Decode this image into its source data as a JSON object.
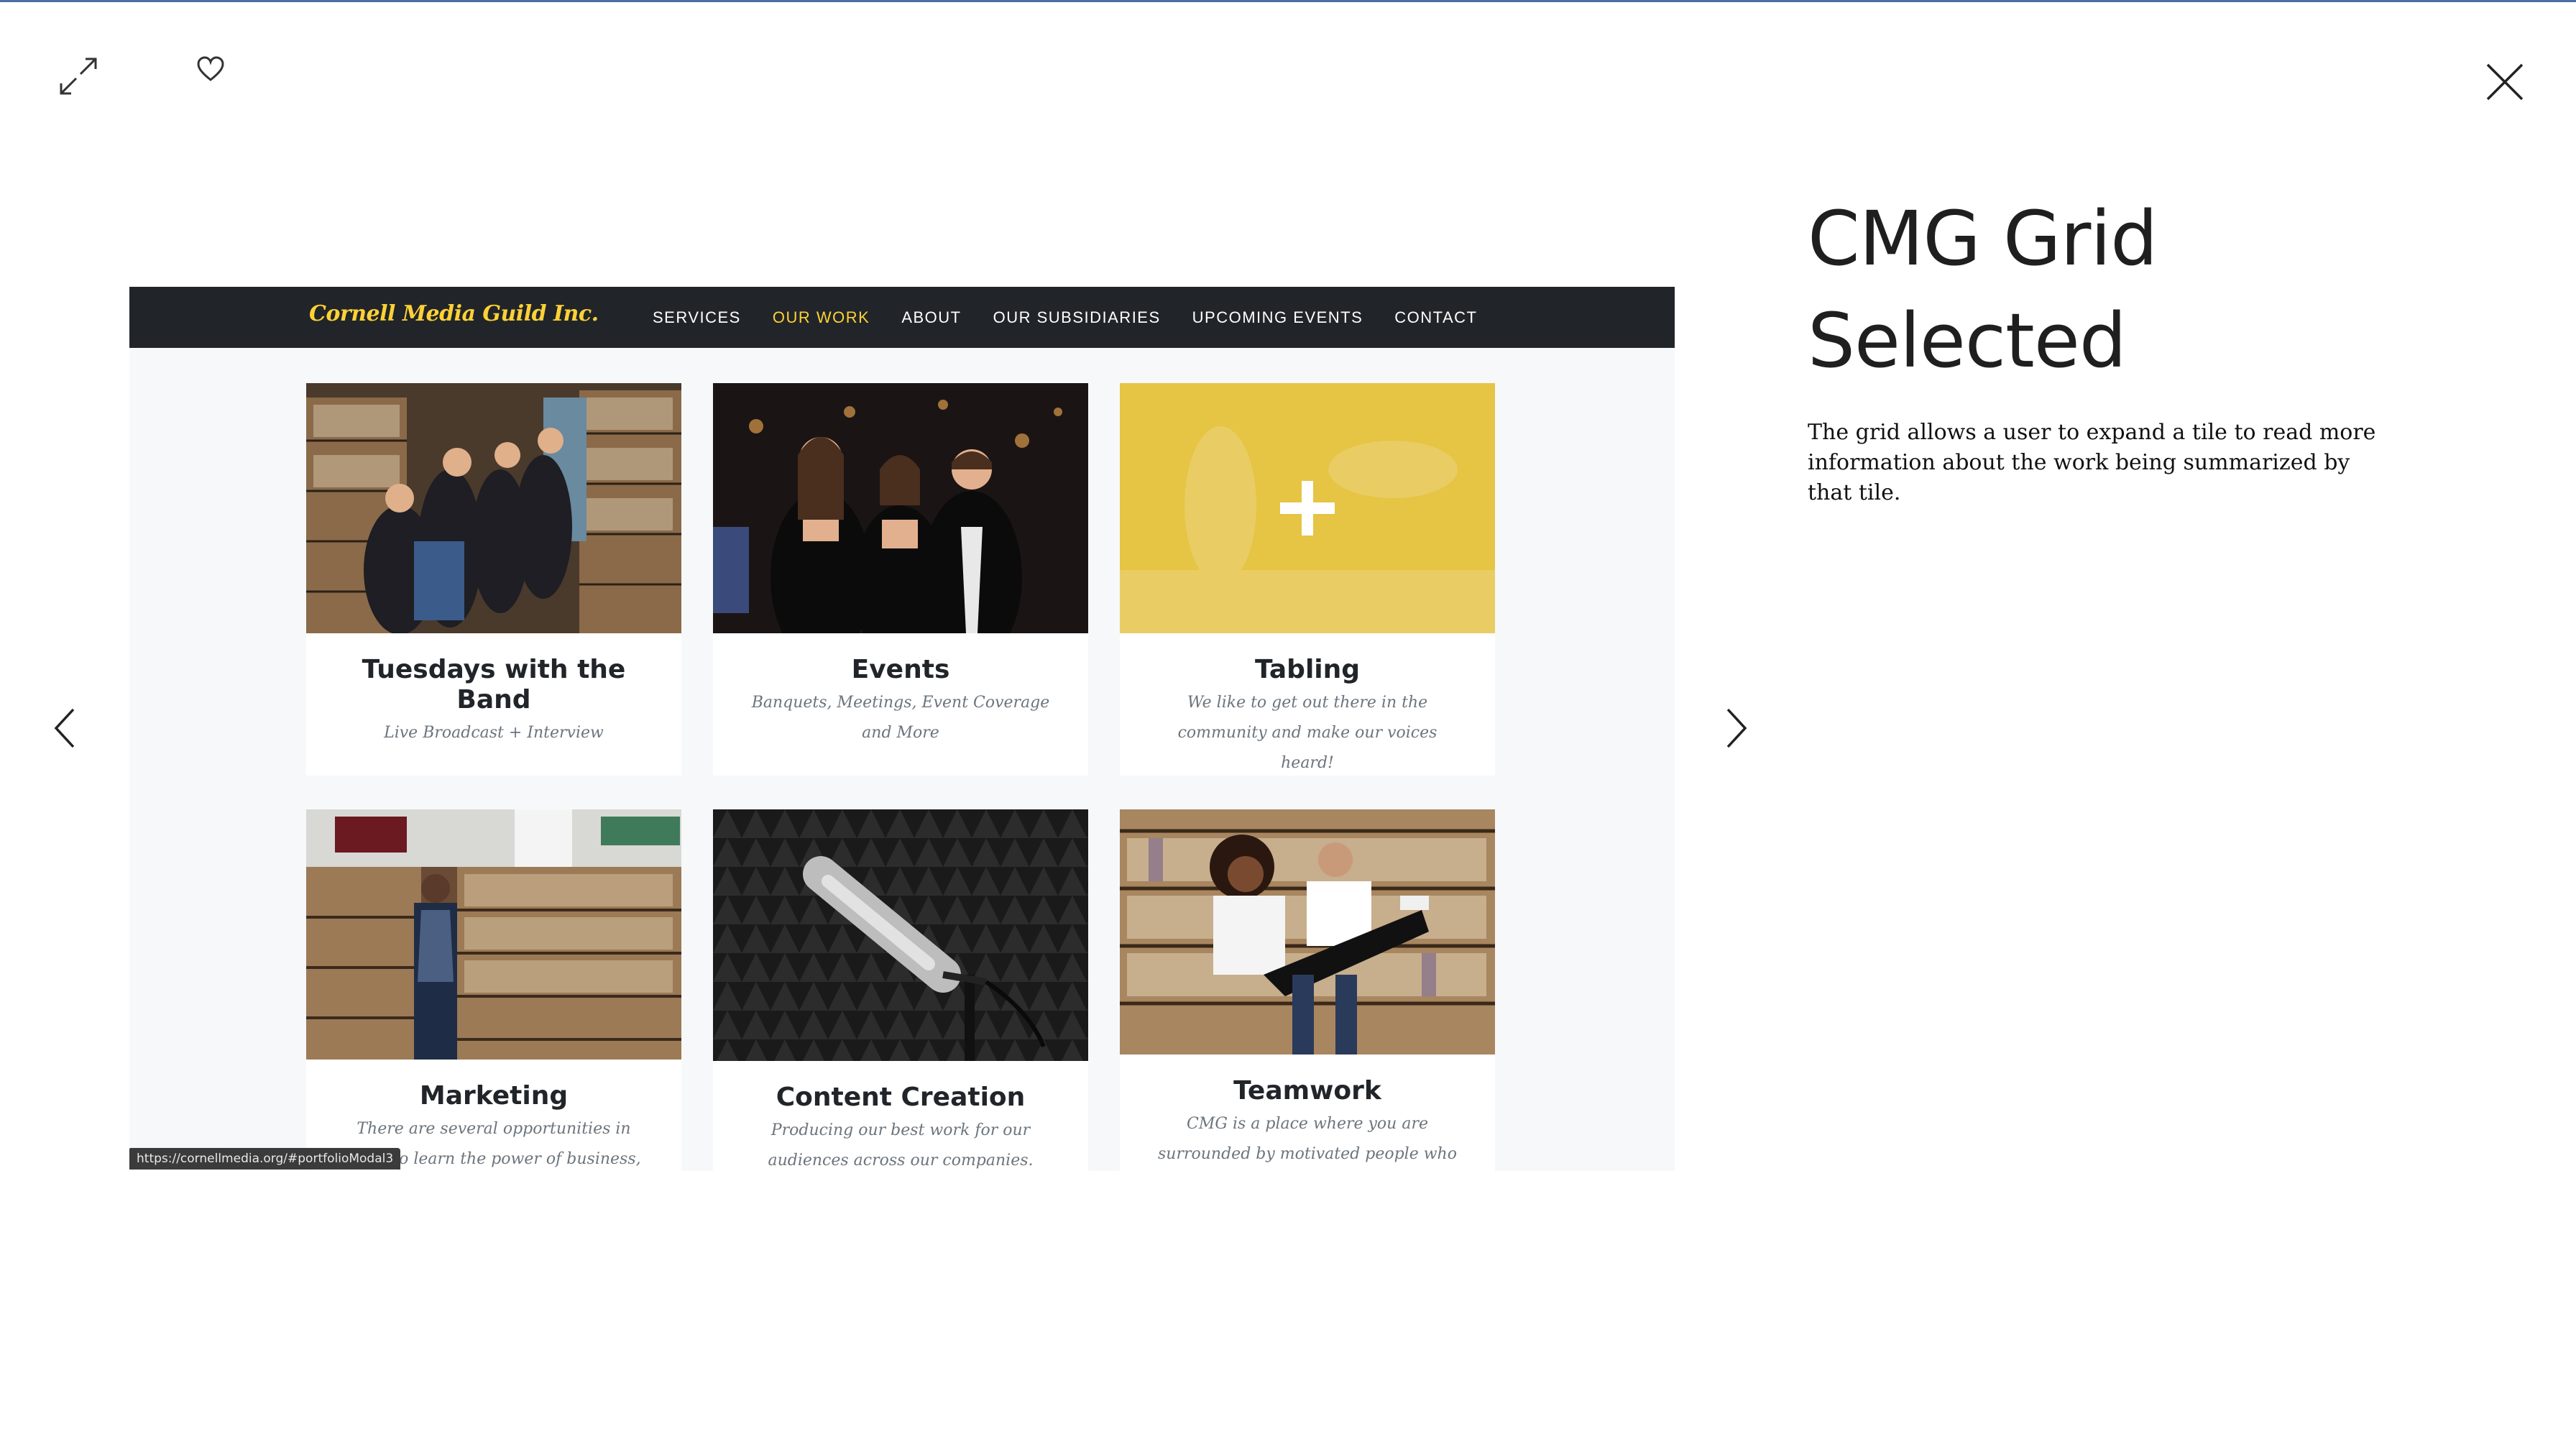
{
  "lightbox": {
    "expand_icon": "expand-icon",
    "like_icon": "heart-icon",
    "close_icon": "close-icon",
    "prev_icon": "chevron-left-icon",
    "next_icon": "chevron-right-icon"
  },
  "panel": {
    "title_line1": "CMG Grid",
    "title_line2": "Selected",
    "description": "The grid allows a user to expand a tile to read more information about the work being summarized by that tile."
  },
  "site": {
    "brand": "Cornell Media Guild Inc.",
    "nav": [
      {
        "label": "SERVICES",
        "active": false
      },
      {
        "label": "OUR WORK",
        "active": true
      },
      {
        "label": "ABOUT",
        "active": false
      },
      {
        "label": "OUR SUBSIDIARIES",
        "active": false
      },
      {
        "label": "UPCOMING EVENTS",
        "active": false
      },
      {
        "label": "CONTACT",
        "active": false
      }
    ],
    "accent": "#fed136",
    "nav_bg": "#212529",
    "tiles": [
      {
        "title": "Tuesdays with the Band",
        "desc": "Live Broadcast + Interview"
      },
      {
        "title": "Events",
        "desc": "Banquets, Meetings, Event Coverage and More"
      },
      {
        "title": "Tabling",
        "desc": "We like to get out there in the community and make our voices heard!"
      },
      {
        "title": "Marketing",
        "desc": "There are several opportunities in CMG to learn the power of business, branding"
      },
      {
        "title": "Content Creation",
        "desc": "Producing our best work for our audiences across our companies."
      },
      {
        "title": "Teamwork",
        "desc": "CMG is a place where you are surrounded by motivated people who"
      }
    ]
  },
  "status_bar": {
    "url": "https://cornellmedia.org/#portfolioModal3"
  }
}
